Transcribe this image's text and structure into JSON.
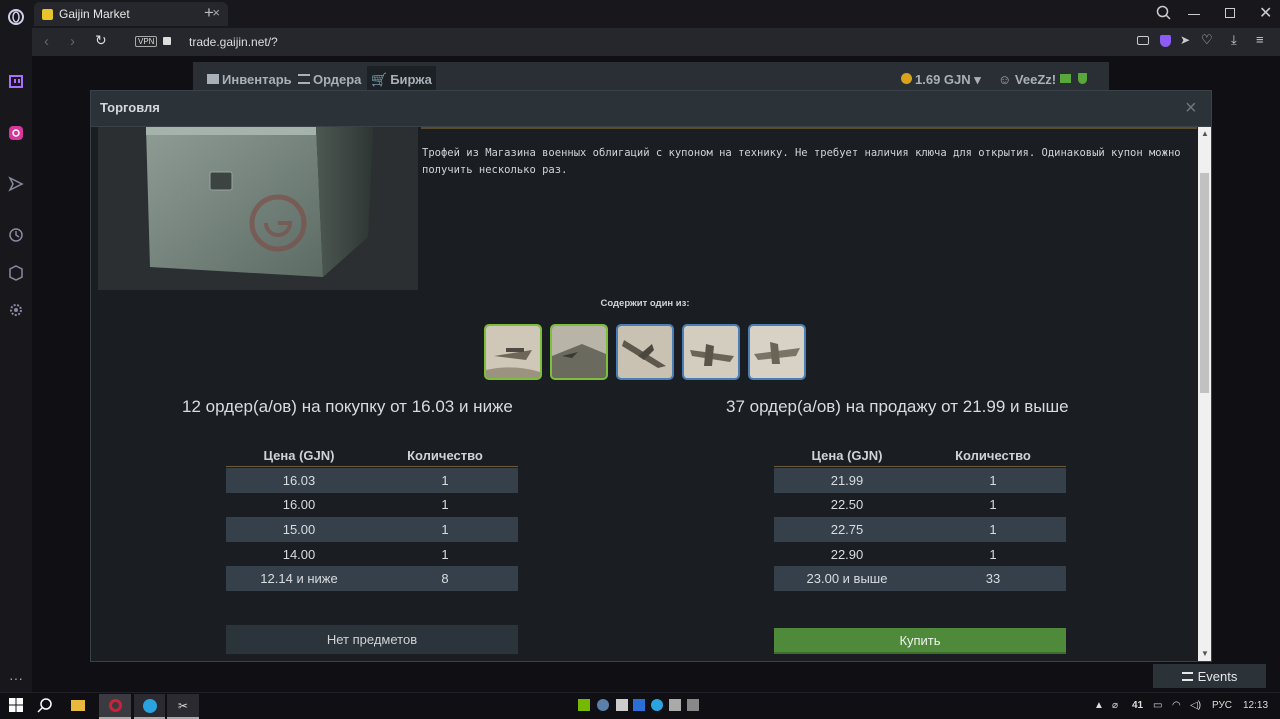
{
  "browser": {
    "tab_title": "Gaijin Market",
    "new_tab": "+",
    "vpn_badge": "VPN",
    "url": "trade.gaijin.net/?"
  },
  "site_nav": {
    "tabs": [
      "Инвентарь",
      "Ордера",
      "Биржа"
    ],
    "balance": "1.69 GJN",
    "username": "VeeZz!"
  },
  "modal": {
    "title": "Торговля",
    "close": "×",
    "description": "Трофей из Магазина военных облигаций с купоном на технику. Не требует наличия ключа для открытия. Одинаковый купон можно получить несколько раз.",
    "contains_label": "Содержит один из:",
    "buy_caption": "12 ордер(а/ов) на покупку от 16.03 и ниже",
    "sell_caption": "37 ордер(а/ов) на продажу от 21.99 и выше",
    "col_price": "Цена (GJN)",
    "col_qty": "Количество",
    "buy_orders": [
      {
        "price": "16.03",
        "qty": "1"
      },
      {
        "price": "16.00",
        "qty": "1"
      },
      {
        "price": "15.00",
        "qty": "1"
      },
      {
        "price": "14.00",
        "qty": "1"
      },
      {
        "price": "12.14 и ниже",
        "qty": "8"
      }
    ],
    "sell_orders": [
      {
        "price": "21.99",
        "qty": "1"
      },
      {
        "price": "22.50",
        "qty": "1"
      },
      {
        "price": "22.75",
        "qty": "1"
      },
      {
        "price": "22.90",
        "qty": "1"
      },
      {
        "price": "23.00 и выше",
        "qty": "33"
      }
    ],
    "no_items": "Нет предметов",
    "buy_button": "Купить"
  },
  "events_button": "Events",
  "taskbar": {
    "temp": "41",
    "lang": "РУС",
    "time": "12:13"
  },
  "colors": {
    "accent_green": "#4e8a3a",
    "thumb_border_green": "#7bbf3a",
    "thumb_border_blue": "#4a7fb5",
    "row_stripe": "#35404b"
  }
}
